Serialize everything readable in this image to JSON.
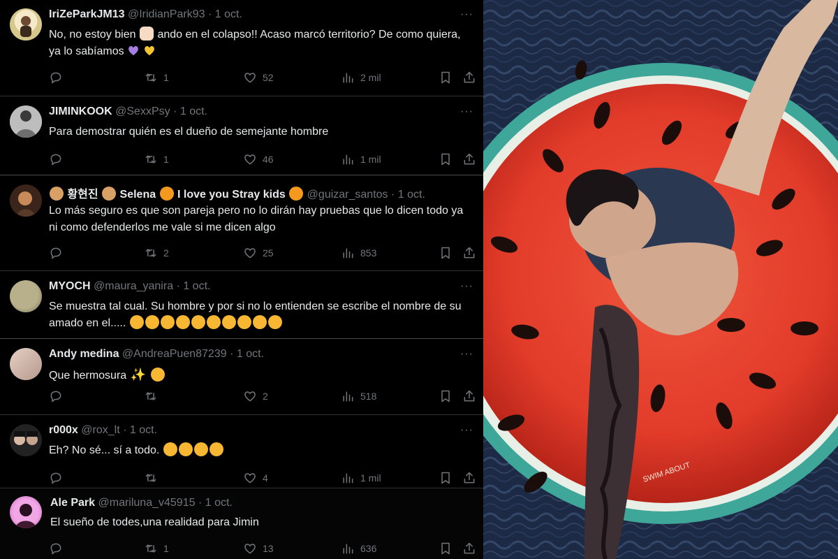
{
  "tweets": [
    {
      "name": "IriZeParkJM13",
      "handle": "@IridianPark93",
      "date": "1 oct.",
      "text1": "No, no estoy bien",
      "text2": "ando en el colapso!! Acaso marcó territorio? De como quiera, ya lo sabíamos",
      "replies": "",
      "retweets": "1",
      "likes": "52",
      "views": "2 mil"
    },
    {
      "name": "JIMINKOOK",
      "handle": "@SexxPsy",
      "date": "1 oct.",
      "text1": "Para demostrar quién es el dueño de semejante hombre",
      "replies": "",
      "retweets": "1",
      "likes": "46",
      "views": "1 mil"
    },
    {
      "name_a": "황현진",
      "name_b": "Selena",
      "name_c": "I love you Stray kids",
      "handle": "@guizar_santos",
      "date": "1 oct.",
      "text1": "Lo más seguro es que son pareja pero no lo dirán hay pruebas que lo dicen todo  ya ni como defenderlos me vale si me dicen algo",
      "replies": "",
      "retweets": "2",
      "likes": "25",
      "views": "853"
    },
    {
      "name": "MYOCH",
      "handle": "@maura_yanira",
      "date": "1 oct.",
      "text1": "Se muestra tal cual. Su hombre y por si no lo entienden se escribe el nombre de su amado  en el.....",
      "replies": "",
      "retweets": "",
      "likes": "",
      "views": ""
    },
    {
      "name": "Andy medina",
      "handle": "@AndreaPuen87239",
      "date": "1 oct.",
      "text1": "Que hermosura",
      "replies": "",
      "retweets": "",
      "likes": "2",
      "views": "518"
    },
    {
      "name": "r000x",
      "handle": "@rox_lt",
      "date": "1 oct.",
      "text1": "Eh? No sé... sí a todo.",
      "replies": "",
      "retweets": "",
      "likes": "4",
      "views": "1 mil"
    },
    {
      "name": "Ale Park",
      "handle": "@mariluna_v45915",
      "date": "1 oct.",
      "text1": "El sueño de todes,una realidad para Jimin",
      "replies": "",
      "retweets": "1",
      "likes": "13",
      "views": "636"
    }
  ],
  "dot": "·",
  "more": "···",
  "photo": {
    "float_text": "SWIM ABOUT",
    "colors": {
      "water": "#1d2a45",
      "float_red": "#e23b2a",
      "float_teal": "#3fa79a",
      "seed": "#1a0d0a"
    }
  }
}
